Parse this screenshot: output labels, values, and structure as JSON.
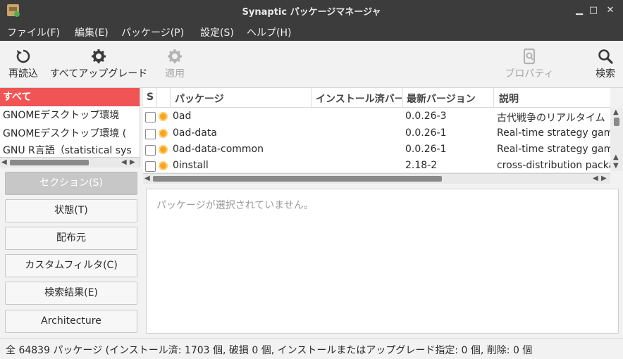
{
  "window": {
    "title": "Synaptic パッケージマネージャ"
  },
  "menu": [
    "ファイル(F)",
    "編集(E)",
    "パッケージ(P)",
    "設定(S)",
    "ヘルプ(H)"
  ],
  "toolbar": {
    "reload": "再読込",
    "mark_all_upgrades": "すべてアップグレード",
    "apply": "適用",
    "properties": "プロパティ",
    "search": "検索"
  },
  "sections": [
    "すべて",
    "GNOMEデスクトップ環境",
    "GNOMEデスクトップ環境 (",
    "GNU R言語（statistical sys"
  ],
  "filter_buttons": [
    "セクション(S)",
    "状態(T)",
    "配布元",
    "カスタムフィルタ(C)",
    "検索結果(E)",
    "Architecture"
  ],
  "columns": {
    "s": "S",
    "package": "パッケージ",
    "installed": "インストール済バージョン",
    "latest": "最新バージョン",
    "description": "説明"
  },
  "packages": [
    {
      "name": "0ad",
      "latest": "0.0.26-3",
      "description": "古代戦争のリアルタイム"
    },
    {
      "name": "0ad-data",
      "latest": "0.0.26-1",
      "description": "Real-time strategy game"
    },
    {
      "name": "0ad-data-common",
      "latest": "0.0.26-1",
      "description": "Real-time strategy game"
    },
    {
      "name": "0install",
      "latest": "2.18-2",
      "description": "cross-distribution packa"
    }
  ],
  "details": {
    "empty": "パッケージが選択されていません。"
  },
  "status": "全 64839 パッケージ (インストール済: 1703 個, 破損 0 個, インストールまたはアップグレード指定: 0 個, 削除: 0 個"
}
